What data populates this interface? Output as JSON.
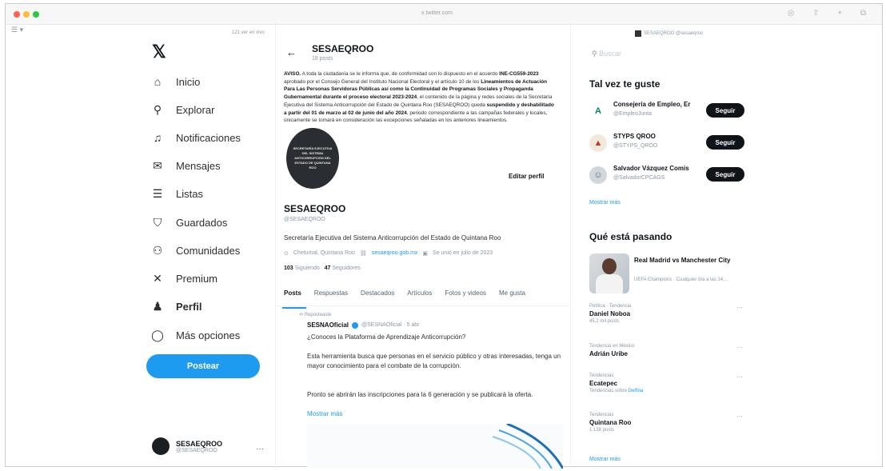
{
  "browser": {
    "url": "x.twitter.com"
  },
  "top_notice": "121 ver en vivo",
  "nav": {
    "items": [
      {
        "label": "Inicio",
        "icon": "home-icon",
        "glyph": "⌂"
      },
      {
        "label": "Explorar",
        "icon": "search-icon",
        "glyph": "⚲"
      },
      {
        "label": "Notificaciones",
        "icon": "bell-icon",
        "glyph": "♫"
      },
      {
        "label": "Mensajes",
        "icon": "mail-icon",
        "glyph": "✉"
      },
      {
        "label": "Listas",
        "icon": "list-icon",
        "glyph": "☰"
      },
      {
        "label": "Guardados",
        "icon": "bookmark-icon",
        "glyph": "⛉"
      },
      {
        "label": "Comunidades",
        "icon": "communities-icon",
        "glyph": "⚇"
      },
      {
        "label": "Premium",
        "icon": "x-premium-icon",
        "glyph": "✕"
      },
      {
        "label": "Perfil",
        "icon": "person-icon",
        "glyph": "♟"
      },
      {
        "label": "Más opciones",
        "icon": "more-circle-icon",
        "glyph": "◯"
      }
    ],
    "post_label": "Postear"
  },
  "account": {
    "name": "SESAEQROO",
    "handle": "@SESAEQROO",
    "dots": "···"
  },
  "header": {
    "back": "←",
    "name": "SESAEQROO",
    "posts": "18 posts"
  },
  "notice": {
    "p1": "AVISO.",
    "p2": " A toda la ciudadanía se le informa que, de conformidad con lo dispuesto en el acuerdo ",
    "p3": "INE-CG559-2023",
    "p4": " aprobado por el Consejo General del Instituto Nacional Electoral y el artículo 10 de los ",
    "p5": "Lineamientos de Actuación Para Las Personas Servidoras Públicas así como la Continuidad de Programas Sociales y Propaganda Gubernamental durante el proceso electoral 2023-2024",
    "p6": ", el contenido de la página y redes sociales de la Secretaría Ejecutiva del Sistema Anticorrupción del Estado de Quintana Roo (SESAEQROO) queda ",
    "p7": "suspendido y deshabilitado a partir del 01 de marzo al 02 de junio del año 2024",
    "p8": ", periodo correspondiente a las campañas federales y locales, únicamente se tomará en consideración las excepciones señaladas en los anteriores lineamientos."
  },
  "avatar_text": "SECRETARÍA EJECUTIVA DEL SISTEMA ANTICORRUPCIÓN DEL ESTADO DE QUINTANA ROO",
  "edit_profile": "Editar perfil",
  "profile": {
    "name": "SESAEQROO",
    "handle": "@SESAEQROO",
    "bio": "Secretaría Ejecutiva del Sistema Anticorrupción del Estado de Quintana Roo",
    "location": "Chetumal, Quintana Roo",
    "link": "sesaeqroo.gob.mx",
    "joined": "Se unió en julio de 2023",
    "following_count": "103",
    "following_label": "Siguiendo",
    "followers_count": "47",
    "followers_label": "Seguidores"
  },
  "tabs": [
    "Posts",
    "Respuestas",
    "Destacados",
    "Artículos",
    "Fotos y videos",
    "Me gusta"
  ],
  "tweet": {
    "repost_label": "Reposteaste",
    "author": "SESNAOficial",
    "handle": "@SESNAOficial · 5 abr",
    "line1": "¿Conoces la Plataforma de Aprendizaje Anticorrupción?",
    "line2": "Esta herramienta busca que personas en el servicio público y otras interesadas, tenga un mayor conocimiento para el combate de la corrupción.",
    "line3": "Pronto se abrirán las inscripciones para la 6 generación y se publicará la oferta.",
    "more": "Mostrar más"
  },
  "right": {
    "search_placeholder": "Buscar",
    "top_account": "SESAEQROO @sesaeqroo",
    "suggestions_title": "Tal vez te guste",
    "suggestions": [
      {
        "name": "Consejería de Empleo, Er",
        "handle": "@EmpleoJunta",
        "avatar_glyph": "A",
        "avatar_color": "#ffffff",
        "glyph_color": "#00875a"
      },
      {
        "name": "STYPS QROO",
        "handle": "@STYPS_QROO",
        "avatar_glyph": "▲",
        "avatar_color": "#f1e9da",
        "glyph_color": "#c0392b"
      },
      {
        "name": "Salvador Vázquez Comis",
        "handle": "@SalvadorCPCAGS",
        "avatar_glyph": "☺",
        "avatar_color": "#cfd6dc",
        "glyph_color": "#5b6670"
      }
    ],
    "follow_label": "Seguir",
    "show_more": "Mostrar más",
    "trends_title": "Qué está pasando",
    "news": {
      "title": "Real Madrid vs Manchester City",
      "sub": "UEFA Champions · Cualquier día a las 14:..."
    },
    "trends": [
      {
        "context": "Política · Tendencia",
        "name": "Daniel Noboa",
        "count": "45,2 mil posts",
        "link": ""
      },
      {
        "context": "Tendencia en México",
        "name": "Adrián Uribe",
        "count": "",
        "link": ""
      },
      {
        "context": "Tendencias",
        "name": "Ecatepec",
        "count": "Tendencias sobre ",
        "link": "Delfina"
      },
      {
        "context": "Tendencias",
        "name": "Quintana Roo",
        "count": "1.138 posts",
        "link": ""
      }
    ],
    "show_more2": "Mostrar más"
  },
  "colors": {
    "accent": "#1d9bf0",
    "follow_bg": "#0f1419"
  }
}
